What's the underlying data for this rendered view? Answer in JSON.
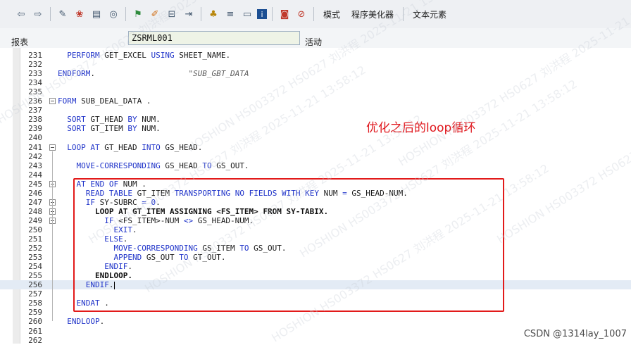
{
  "toolbar": {
    "icons": [
      "back-arrow-icon",
      "forward-arrow-icon",
      "check-syntax-icon",
      "object-list-icon",
      "other-object-icon",
      "where-used-icon",
      "activate-icon",
      "edit-icon",
      "test-icon",
      "debug-icon",
      "hierarchy-icon",
      "pattern-icon",
      "display-object-list-icon",
      "info-icon",
      "help-icon",
      "stop-icon"
    ],
    "mode_label": "模式",
    "pretty_printer_label": "程序美化器",
    "text_elements_label": "文本元素"
  },
  "fieldbar": {
    "type_label": "报表",
    "program_name": "ZSRML001",
    "status_label": "活动"
  },
  "editor": {
    "lines": [
      {
        "no": "231",
        "code": "  PERFORM GET_EXCEL USING SHEET_NAME."
      },
      {
        "no": "232",
        "code": ""
      },
      {
        "no": "233",
        "code": "ENDFORM.                    \"SUB_GBT_DATA"
      },
      {
        "no": "234",
        "code": ""
      },
      {
        "no": "235",
        "code": ""
      },
      {
        "no": "236",
        "code": "FORM SUB_DEAL_DATA ."
      },
      {
        "no": "237",
        "code": ""
      },
      {
        "no": "238",
        "code": "  SORT GT_HEAD BY NUM."
      },
      {
        "no": "239",
        "code": "  SORT GT_ITEM BY NUM."
      },
      {
        "no": "240",
        "code": ""
      },
      {
        "no": "241",
        "code": "  LOOP AT GT_HEAD INTO GS_HEAD."
      },
      {
        "no": "242",
        "code": ""
      },
      {
        "no": "243",
        "code": "    MOVE-CORRESPONDING GS_HEAD TO GS_OUT."
      },
      {
        "no": "244",
        "code": ""
      },
      {
        "no": "245",
        "code": "    AT END OF NUM ."
      },
      {
        "no": "246",
        "code": "      READ TABLE GT_ITEM TRANSPORTING NO FIELDS WITH KEY NUM = GS_HEAD-NUM."
      },
      {
        "no": "247",
        "code": "      IF SY-SUBRC = 0."
      },
      {
        "no": "248",
        "code": "        LOOP AT GT_ITEM ASSIGNING <FS_ITEM> FROM SY-TABIX."
      },
      {
        "no": "249",
        "code": "          IF <FS_ITEM>-NUM <> GS_HEAD-NUM."
      },
      {
        "no": "250",
        "code": "            EXIT."
      },
      {
        "no": "251",
        "code": "          ELSE."
      },
      {
        "no": "252",
        "code": "            MOVE-CORRESPONDING GS_ITEM TO GS_OUT."
      },
      {
        "no": "253",
        "code": "            APPEND GS_OUT TO GT_OUT."
      },
      {
        "no": "254",
        "code": "          ENDIF."
      },
      {
        "no": "255",
        "code": "        ENDLOOP."
      },
      {
        "no": "256",
        "code": "      ENDIF."
      },
      {
        "no": "257",
        "code": ""
      },
      {
        "no": "258",
        "code": "    ENDAT ."
      },
      {
        "no": "259",
        "code": ""
      },
      {
        "no": "260",
        "code": "  ENDLOOP."
      },
      {
        "no": "261",
        "code": ""
      },
      {
        "no": "262",
        "code": ""
      }
    ]
  },
  "annotation": {
    "text": "优化之后的loop循环",
    "color": "#e0161c"
  },
  "credit": "CSDN @1314lay_1007",
  "watermarks": [
    "HOSHION HS003372 HS0627 刘洪程 2025-11-21 13:58:12"
  ]
}
